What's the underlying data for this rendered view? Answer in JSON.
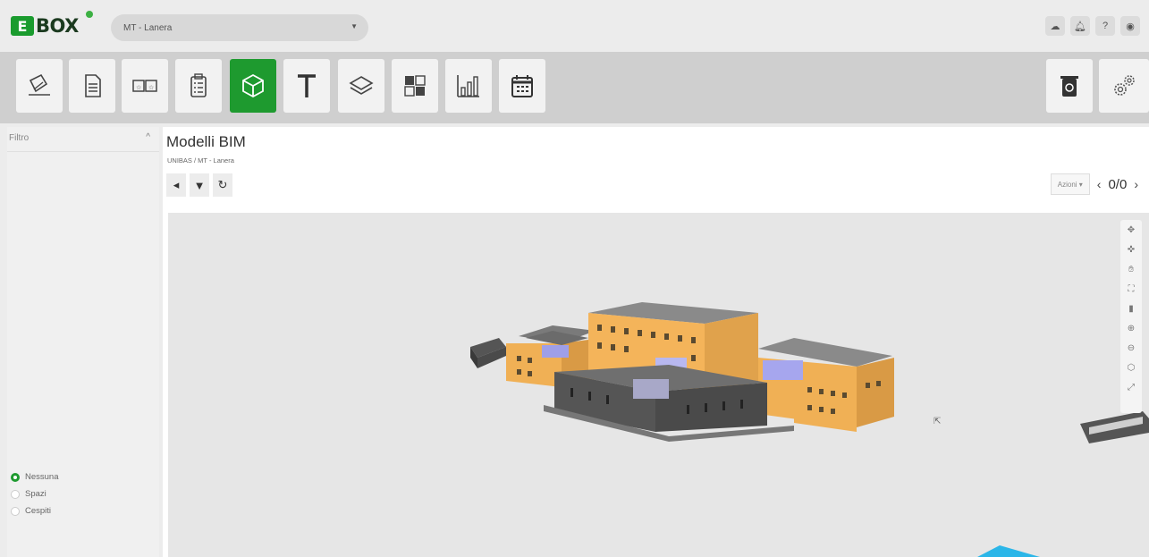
{
  "app": {
    "logo_text": "BOX",
    "logo_mark": "E"
  },
  "header": {
    "project_select_value": "MT - Lanera",
    "top_icons": [
      "cloud-notifications-icon",
      "bell-icon",
      "help-icon",
      "user-icon"
    ]
  },
  "toolbar": {
    "tools": [
      "sign-document-icon",
      "document-icon",
      "tickets-icon",
      "checklist-icon",
      "bim-cube-icon",
      "text-icon",
      "layers-icon",
      "puzzle-icon",
      "chart-icon",
      "calendar-icon"
    ],
    "active_tool": "bim-cube-icon",
    "right_tools": [
      "recycle-bin-icon",
      "settings-gears-icon"
    ],
    "accent_color": "#1e9a2f"
  },
  "sidebar": {
    "filter_label": "Filtro",
    "radio_options": [
      "Nessuna",
      "Spazi",
      "Cespiti"
    ],
    "selected_option": "Nessuna"
  },
  "main": {
    "title": "Modelli BIM",
    "breadcrumb": "UNIBAS / MT - Lanera",
    "actions_label": "Azioni",
    "pager_text": "0/0"
  },
  "viewer": {
    "nav_tools": [
      "orbit-icon",
      "pan-orbit-icon",
      "hand-pan-icon",
      "fit-view-icon",
      "map-icon",
      "zoom-in-icon",
      "zoom-out-icon",
      "cube-view-icon",
      "fullscreen-icon"
    ]
  }
}
